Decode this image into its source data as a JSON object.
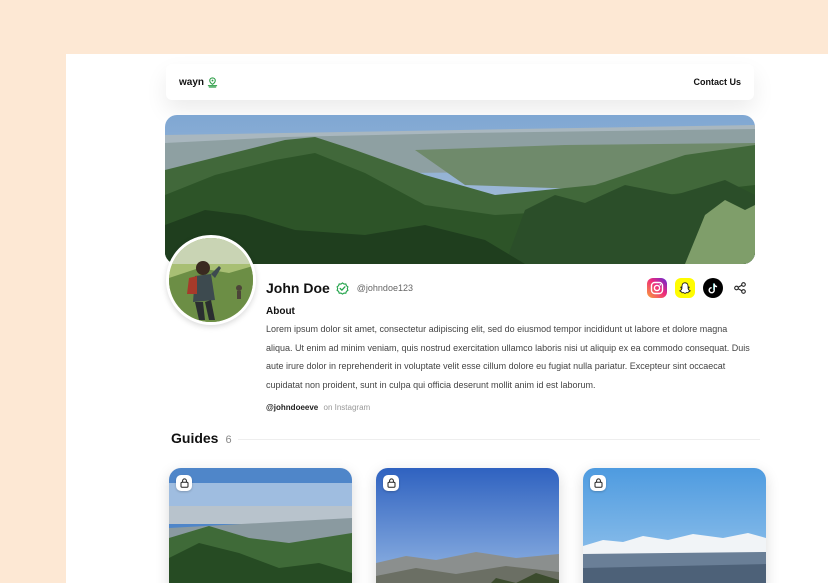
{
  "nav": {
    "logo_text": "wayn",
    "logo_icon": "pin-icon",
    "contact_label": "Contact Us"
  },
  "profile": {
    "name": "John Doe",
    "handle": "@johndoe123",
    "verified_icon": "verified-badge-icon",
    "about_title": "About",
    "about_text": "Lorem ipsum dolor sit amet, consectetur adipiscing elit, sed do eiusmod tempor incididunt ut labore et dolore magna aliqua. Ut enim ad minim veniam, quis nostrud exercitation ullamco laboris nisi ut aliquip ex ea commodo consequat. Duis aute irure dolor in reprehenderit in voluptate velit esse cillum dolore eu fugiat nulla pariatur. Excepteur sint occaecat cupidatat non proident, sunt in culpa qui officia deserunt mollit anim id est laborum.",
    "instagram_handle": "@johndoeeve",
    "instagram_suffix": "on Instagram"
  },
  "socials": [
    {
      "name": "instagram",
      "icon": "instagram-icon"
    },
    {
      "name": "snapchat",
      "icon": "snapchat-icon"
    },
    {
      "name": "tiktok",
      "icon": "tiktok-icon"
    },
    {
      "name": "share",
      "icon": "share-icon"
    }
  ],
  "guides": {
    "title": "Guides",
    "count": "6",
    "cards": [
      {
        "locked": true,
        "icon": "lock-icon"
      },
      {
        "locked": true,
        "icon": "lock-icon"
      },
      {
        "locked": true,
        "icon": "lock-icon"
      }
    ]
  },
  "colors": {
    "background": "#fde8d4",
    "verified": "#22a34a",
    "logo_icon": "#2e9e48"
  }
}
